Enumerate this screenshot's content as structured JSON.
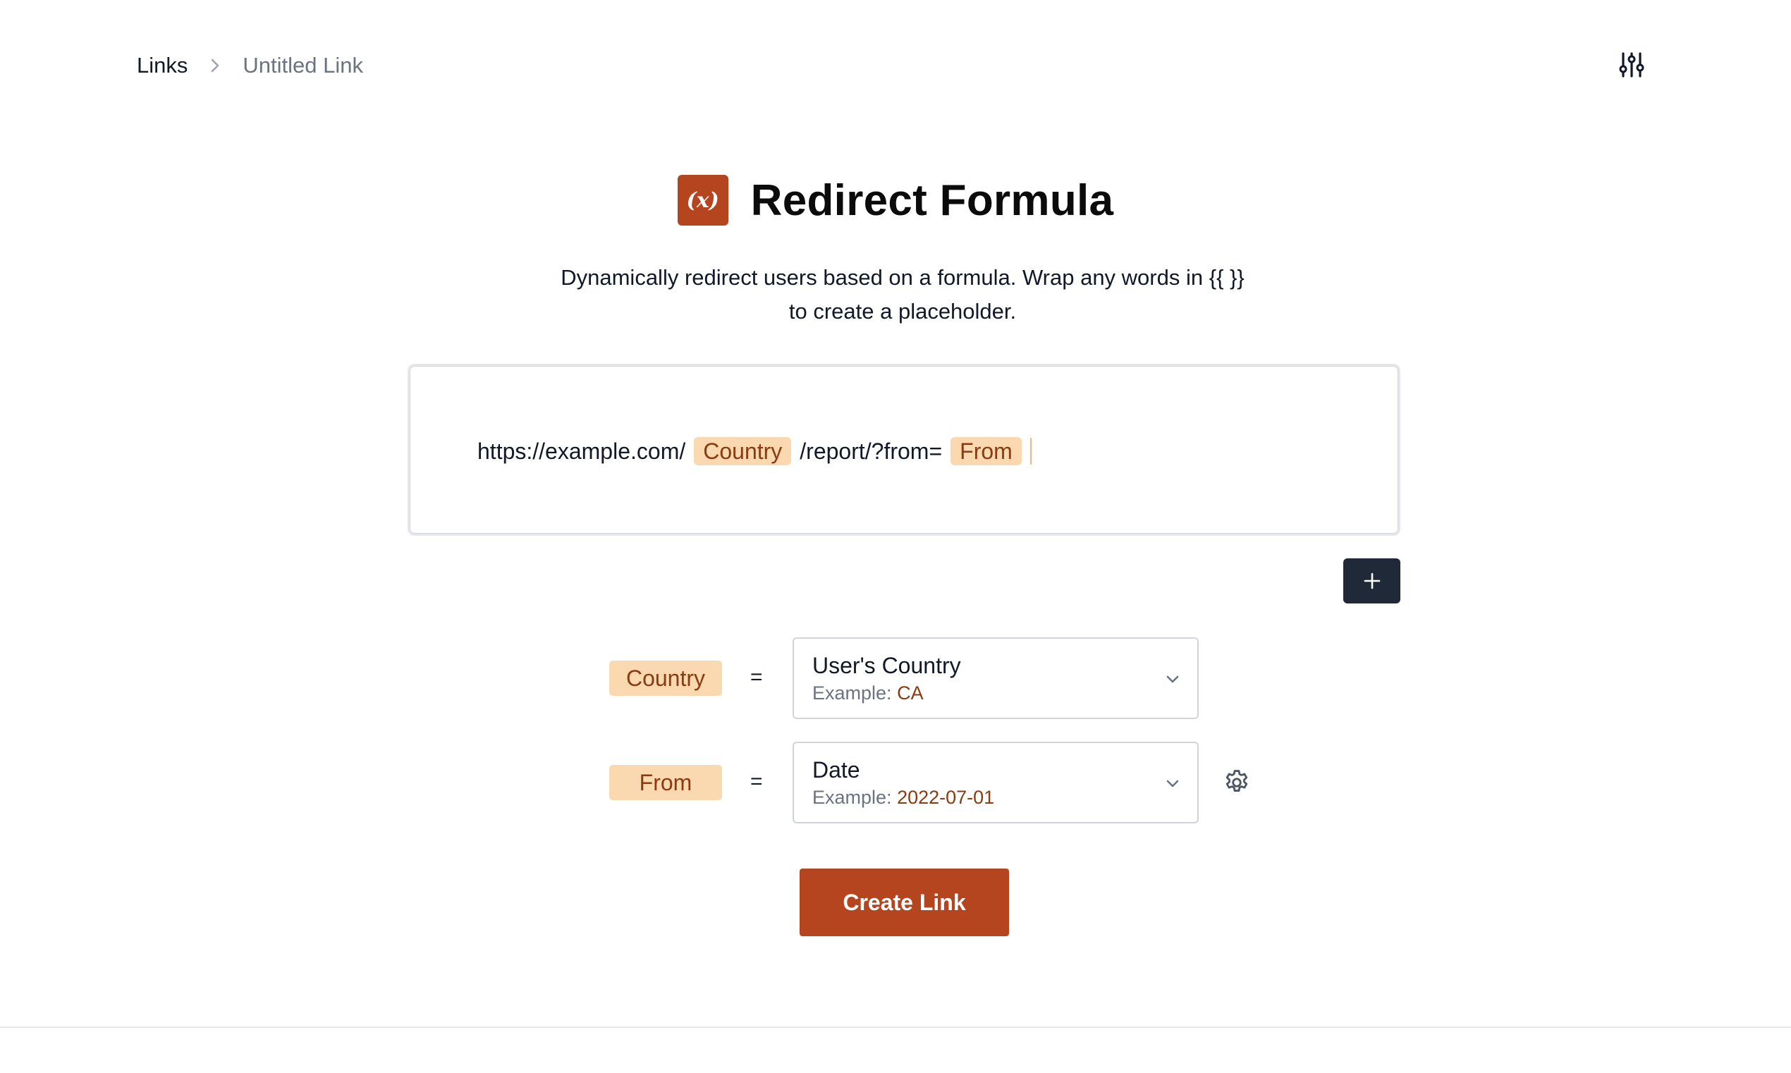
{
  "breadcrumb": {
    "root": "Links",
    "current": "Untitled Link"
  },
  "header": {
    "badge": "(x)",
    "title": "Redirect Formula",
    "description_line1": "Dynamically redirect users based on a formula. Wrap any words in {{ }}",
    "description_line2": "to create a placeholder."
  },
  "formula": {
    "segments": [
      {
        "type": "text",
        "value": "https://example.com/"
      },
      {
        "type": "token",
        "value": "Country"
      },
      {
        "type": "text",
        "value": "/report/?from="
      },
      {
        "type": "token",
        "value": "From"
      }
    ]
  },
  "add_button_label": "+",
  "variables": [
    {
      "name": "Country",
      "equals": "=",
      "source": "User's Country",
      "example_label": "Example:",
      "example_value": "CA",
      "has_settings": false
    },
    {
      "name": "From",
      "equals": "=",
      "source": "Date",
      "example_label": "Example:",
      "example_value": "2022-07-01",
      "has_settings": true
    }
  ],
  "create_button_label": "Create Link",
  "colors": {
    "accent": "#b5451f",
    "token_bg": "#fad9b0",
    "token_text": "#8a3b12",
    "dark_button": "#1f2937"
  },
  "icons": {
    "settings_toggle": "sliders-icon",
    "chevron": "chevron-down-icon",
    "gear": "gear-icon",
    "breadcrumb_separator": "chevron-right-icon"
  }
}
